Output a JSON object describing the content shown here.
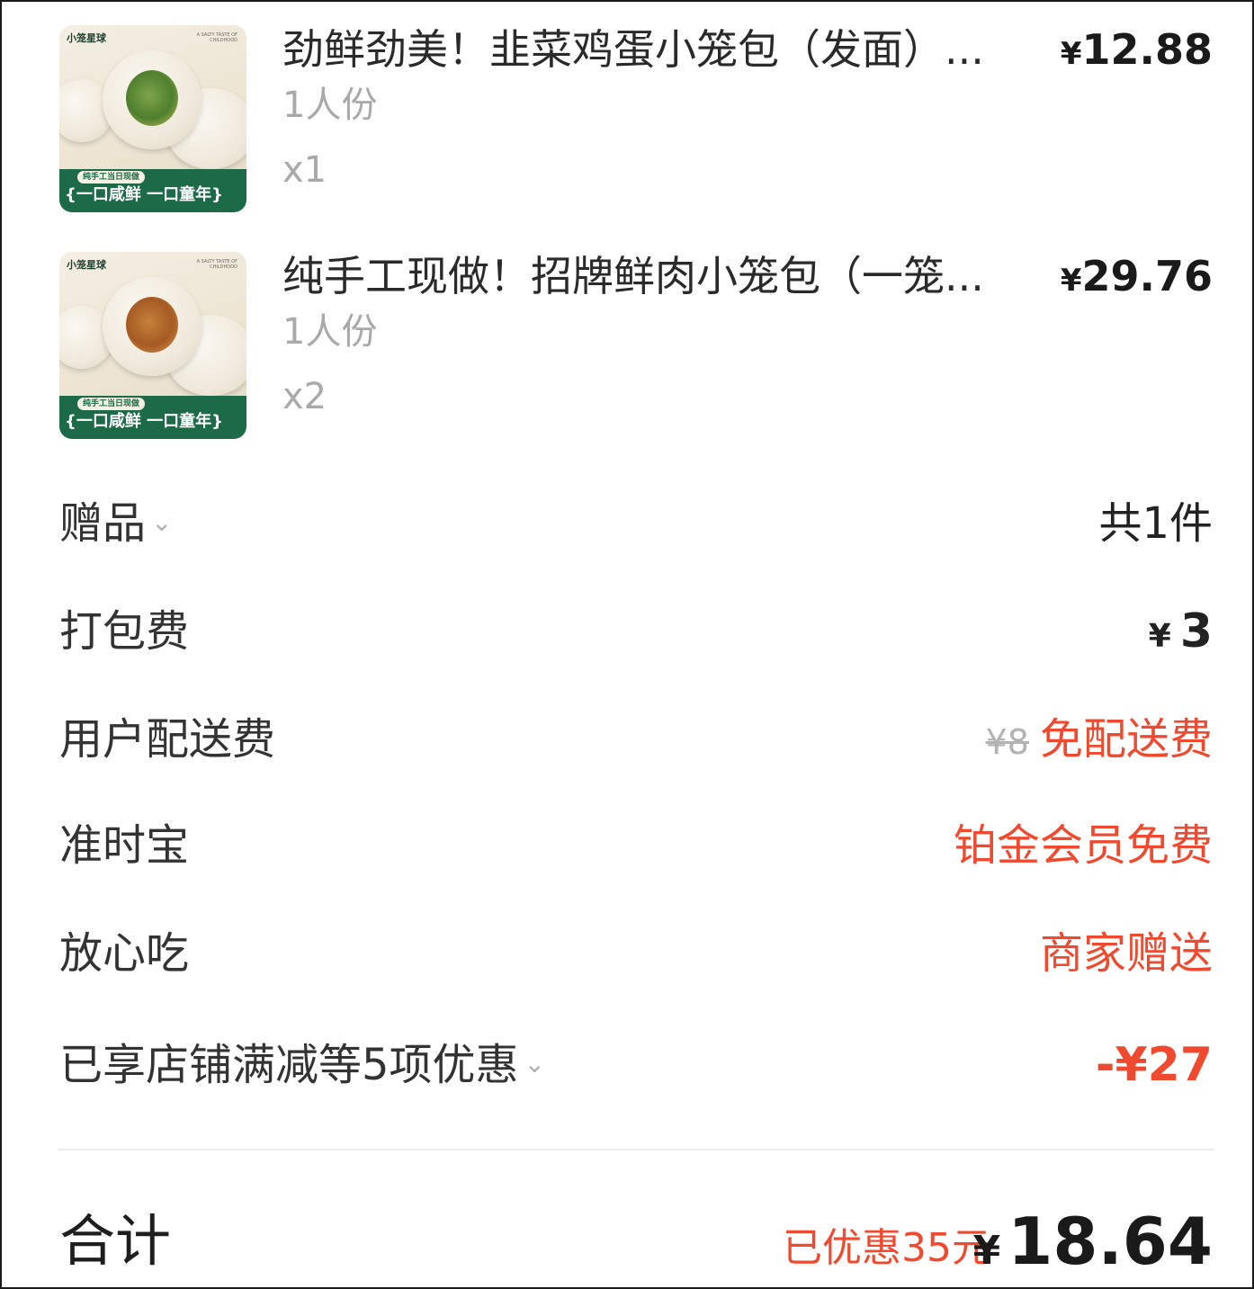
{
  "items": [
    {
      "name": "劲鲜劲美！韭菜鸡蛋小笼包（发面）...",
      "currency": "¥",
      "price": "12.88",
      "spec": "1人份",
      "qty": "x1",
      "thumb": {
        "brand": "小笼星球",
        "tagline": "A SALTY TASTE OF CHILDHOOD",
        "pill": "纯手工当日现做",
        "slogan": "{一口咸鲜 一口童年}",
        "filling_color": "#5b8a34"
      }
    },
    {
      "name": "纯手工现做！招牌鲜肉小笼包（一笼...",
      "currency": "¥",
      "price": "29.76",
      "spec": "1人份",
      "qty": "x2",
      "thumb": {
        "brand": "小笼星球",
        "tagline": "A SALTY TASTE OF CHILDHOOD",
        "pill": "纯手工当日现做",
        "slogan": "{一口咸鲜 一口童年}",
        "filling_color": "#a65a24"
      }
    }
  ],
  "rows": {
    "gift": {
      "label": "赠品",
      "value": "共1件"
    },
    "packing": {
      "label": "打包费",
      "currency": "¥",
      "value": "3"
    },
    "delivery": {
      "label": "用户配送费",
      "original": "¥8",
      "value": "免配送费"
    },
    "ontime": {
      "label": "准时宝",
      "value": "铂金会员免费"
    },
    "safe": {
      "label": "放心吃",
      "value": "商家赠送"
    },
    "discount": {
      "label": "已享店铺满减等5项优惠",
      "value": "-¥27"
    }
  },
  "total": {
    "label": "合计",
    "saved": "已优惠35元",
    "currency": "¥",
    "value": "18.64"
  },
  "colors": {
    "accent_red": "#ef4a2f",
    "muted_gray": "#a9a9a9",
    "banner_green": "#1c6a48"
  }
}
